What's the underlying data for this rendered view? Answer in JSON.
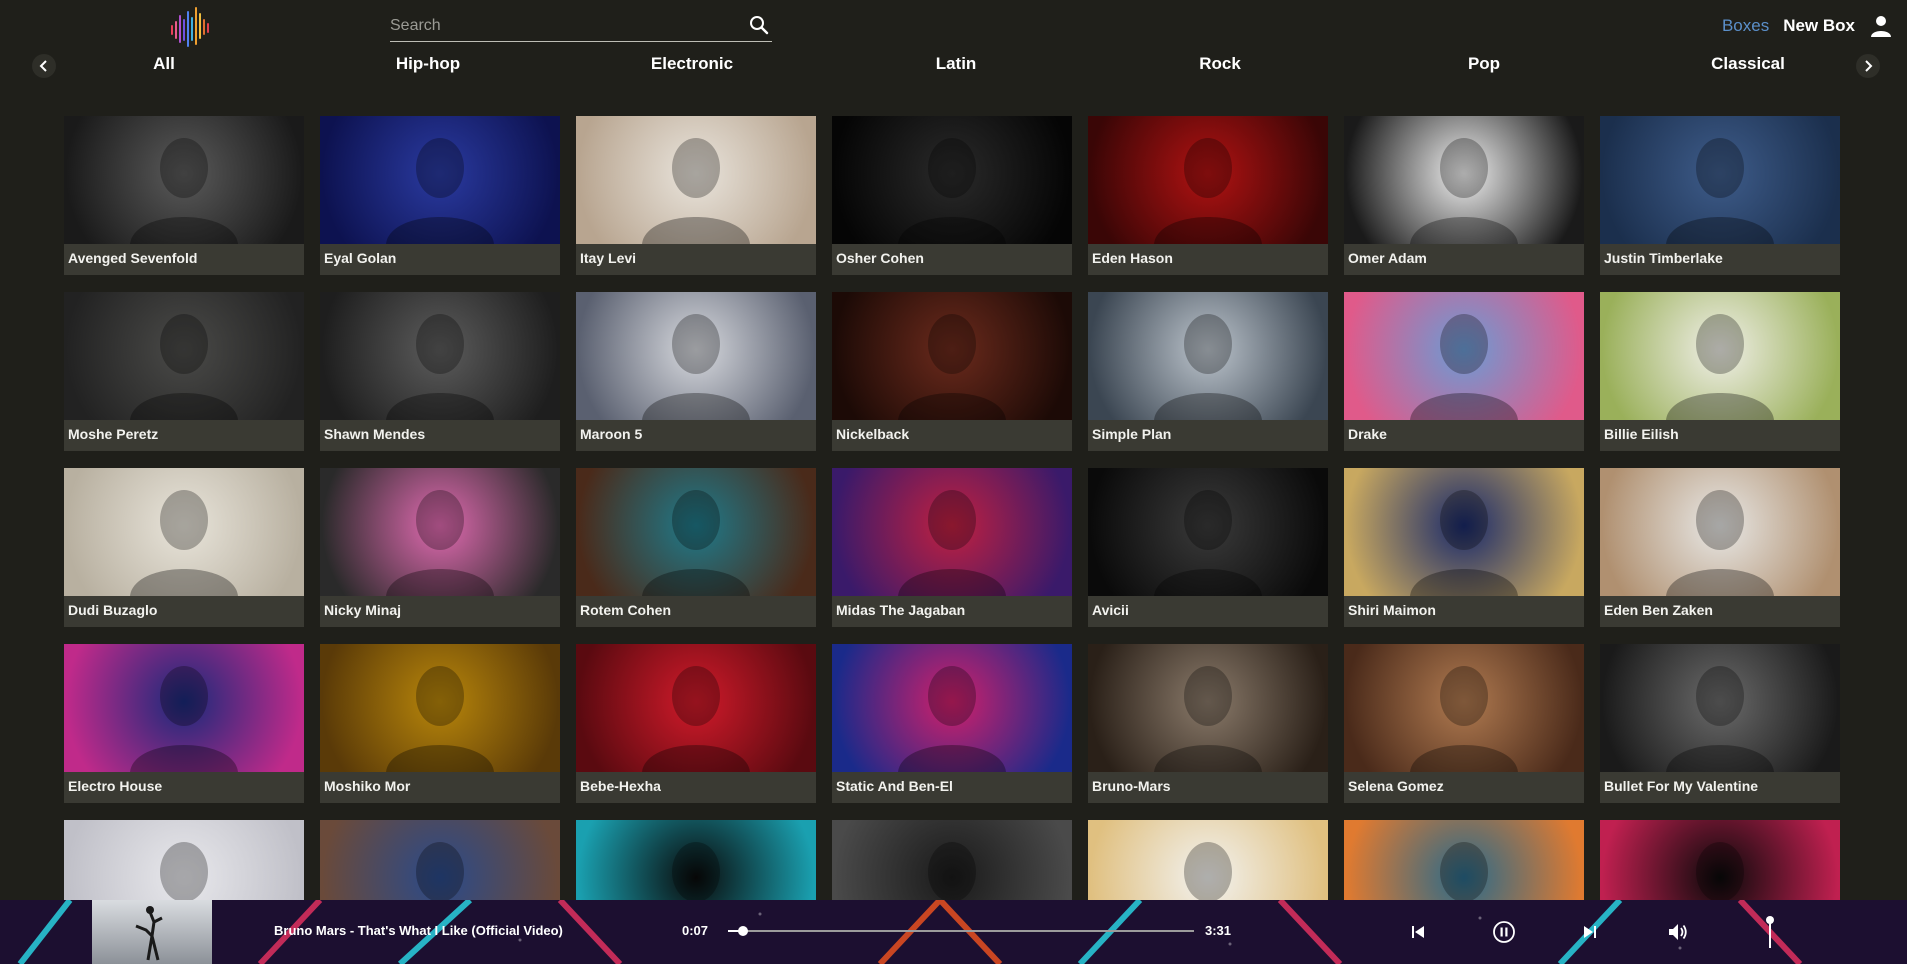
{
  "header": {
    "search_placeholder": "Search",
    "nav_boxes": "Boxes",
    "nav_new_box": "New Box",
    "accent_color": "#5b8fc9"
  },
  "genres": [
    "All",
    "Hip-hop",
    "Electronic",
    "Latin",
    "Rock",
    "Pop",
    "Classical"
  ],
  "artists": [
    {
      "name": "Avenged Sevenfold",
      "colors": [
        "#5a5a5a",
        "#1a1a1a"
      ]
    },
    {
      "name": "Eyal Golan",
      "colors": [
        "#2a3aa0",
        "#0d1250"
      ]
    },
    {
      "name": "Itay Levi",
      "colors": [
        "#e9e4dc",
        "#b8a590"
      ]
    },
    {
      "name": "Osher Cohen",
      "colors": [
        "#2a2a2a",
        "#050505"
      ]
    },
    {
      "name": "Eden Hason",
      "colors": [
        "#b01212",
        "#3a0606"
      ]
    },
    {
      "name": "Omer Adam",
      "colors": [
        "#f0f0f0",
        "#1a1a1a"
      ]
    },
    {
      "name": "Justin Timberlake",
      "colors": [
        "#3e5c8a",
        "#1b2f4d"
      ]
    },
    {
      "name": "Moshe Peretz",
      "colors": [
        "#4a4a48",
        "#222"
      ]
    },
    {
      "name": "Shawn Mendes",
      "colors": [
        "#5c5c5c",
        "#1e1e1e"
      ]
    },
    {
      "name": "Maroon 5",
      "colors": [
        "#d7d9de",
        "#5a6070"
      ]
    },
    {
      "name": "Nickelback",
      "colors": [
        "#6b2a1c",
        "#1c0a06"
      ]
    },
    {
      "name": "Simple Plan",
      "colors": [
        "#bcc4cc",
        "#3b4652"
      ]
    },
    {
      "name": "Drake",
      "colors": [
        "#6b9bd4",
        "#e05a8a"
      ]
    },
    {
      "name": "Billie Eilish",
      "colors": [
        "#f0efe8",
        "#9ab05a"
      ]
    },
    {
      "name": "Dudi Buzaglo",
      "colors": [
        "#e8e4da",
        "#b8b0a0"
      ]
    },
    {
      "name": "Nicky Minaj",
      "colors": [
        "#e06ab0",
        "#2a2a2a"
      ]
    },
    {
      "name": "Rotem Cohen",
      "colors": [
        "#1f7a8a",
        "#4a2a1a"
      ]
    },
    {
      "name": "Midas The Jagaban",
      "colors": [
        "#c02040",
        "#3a1a6a"
      ]
    },
    {
      "name": "Avicii",
      "colors": [
        "#3a3a3a",
        "#0a0a0a"
      ]
    },
    {
      "name": "Shiri Maimon",
      "colors": [
        "#1a2a6a",
        "#c8a860"
      ]
    },
    {
      "name": "Eden Ben Zaken",
      "colors": [
        "#e8e8e6",
        "#b09070"
      ]
    },
    {
      "name": "Electro House",
      "colors": [
        "#1a2a7a",
        "#c02a8a"
      ]
    },
    {
      "name": "Moshiko Mor",
      "colors": [
        "#b8860b",
        "#5a3a08"
      ]
    },
    {
      "name": "Bebe-Hexha",
      "colors": [
        "#d01a2a",
        "#5a0a10"
      ]
    },
    {
      "name": "Static And Ben-El",
      "colors": [
        "#d0206a",
        "#1a2a8a"
      ]
    },
    {
      "name": "Bruno-Mars",
      "colors": [
        "#8a7a6a",
        "#2a2018"
      ]
    },
    {
      "name": "Selena Gomez",
      "colors": [
        "#b07a50",
        "#4a2a1a"
      ]
    },
    {
      "name": "Bullet For My Valentine",
      "colors": [
        "#6a6a6a",
        "#1a1a1a"
      ]
    },
    {
      "name": "",
      "colors": [
        "#e8e8ec",
        "#c0c0c8"
      ]
    },
    {
      "name": "",
      "colors": [
        "#2a4a8a",
        "#6a4a3a"
      ]
    },
    {
      "name": "",
      "colors": [
        "#0a0a0a",
        "#1aa0b0"
      ]
    },
    {
      "name": "",
      "colors": [
        "#1a1a1a",
        "#4a4a4a"
      ]
    },
    {
      "name": "",
      "colors": [
        "#f2f2f0",
        "#e0c080"
      ]
    },
    {
      "name": "",
      "colors": [
        "#2a6a8a",
        "#e07a30"
      ]
    },
    {
      "name": "",
      "colors": [
        "#0a0a0a",
        "#c02050"
      ]
    }
  ],
  "player": {
    "track_title": "Bruno Mars - That's What I Like (Official Video)",
    "elapsed": "0:07",
    "duration": "3:31",
    "progress_fraction": 0.033
  }
}
